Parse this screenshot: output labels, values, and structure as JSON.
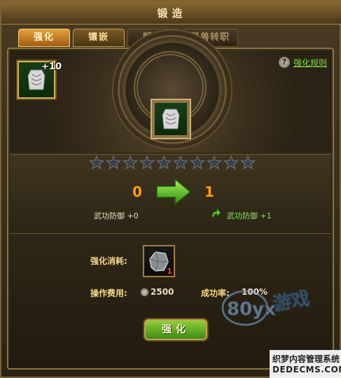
{
  "window": {
    "title": "锻造",
    "close_label": "×"
  },
  "tabs": [
    {
      "label": "强化",
      "state": "active"
    },
    {
      "label": "镶嵌",
      "state": "semi"
    },
    {
      "label": "赋属",
      "state": "inactive"
    },
    {
      "label": "灵兽转职",
      "state": "inactive"
    }
  ],
  "help": {
    "icon": "?",
    "link_text": "强化规则"
  },
  "selected_item": {
    "level_badge": "+10",
    "icon": "armor-icon"
  },
  "stars": {
    "total": 10,
    "filled": 0
  },
  "level": {
    "current": "0",
    "next": "1"
  },
  "stats": {
    "current": "武功防御 +0",
    "next": "武功防御 +1"
  },
  "cost": {
    "label": "强化消耗:",
    "material_quantity": "1",
    "material_icon": "ore-icon"
  },
  "fee": {
    "label": "操作费用:",
    "value": "2500",
    "currency_icon": "silver-coin-icon"
  },
  "success": {
    "label": "成功率:",
    "value": "100%"
  },
  "enhance_button": {
    "label": "强化"
  },
  "watermark": {
    "logo": "80yx 游戏",
    "line1": "织梦内容管理系统",
    "line2": "DEDECMS.COM"
  },
  "colors": {
    "accent_orange": "#ff9a1e",
    "stat_green": "#8be062",
    "link_green": "#7ddc4a",
    "gold": "#f5d88a"
  }
}
